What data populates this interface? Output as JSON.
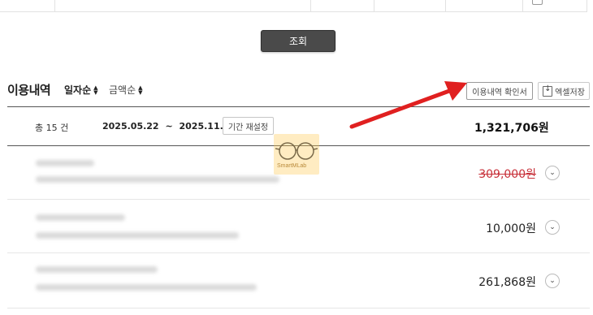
{
  "search": {
    "label": "조회"
  },
  "section": {
    "title": "이용내역",
    "sort_date": "일자순",
    "sort_amount": "금액순",
    "confirm_button": "이용내역 확인서",
    "excel_button": "엑셀저장"
  },
  "summary": {
    "count": "총 15 건",
    "start_date": "2025.05.22",
    "separator": "~",
    "end_date": "2025.11.22",
    "reset_button": "기간 재설정",
    "total": "1,321,706원"
  },
  "rows": [
    {
      "amount": "309,000원",
      "status": "cancelled"
    },
    {
      "amount": "10,000원",
      "status": "normal"
    },
    {
      "amount": "261,868원",
      "status": "normal"
    }
  ],
  "watermark": {
    "text": "SmartMLab"
  },
  "colors": {
    "search_button": "#4a4a4a",
    "cancelled_amount": "#c8313a",
    "arrow": "#e02020"
  },
  "icons": {
    "sort": "sort-updown-icon",
    "excel": "download-icon",
    "expand": "chevron-down-icon"
  }
}
